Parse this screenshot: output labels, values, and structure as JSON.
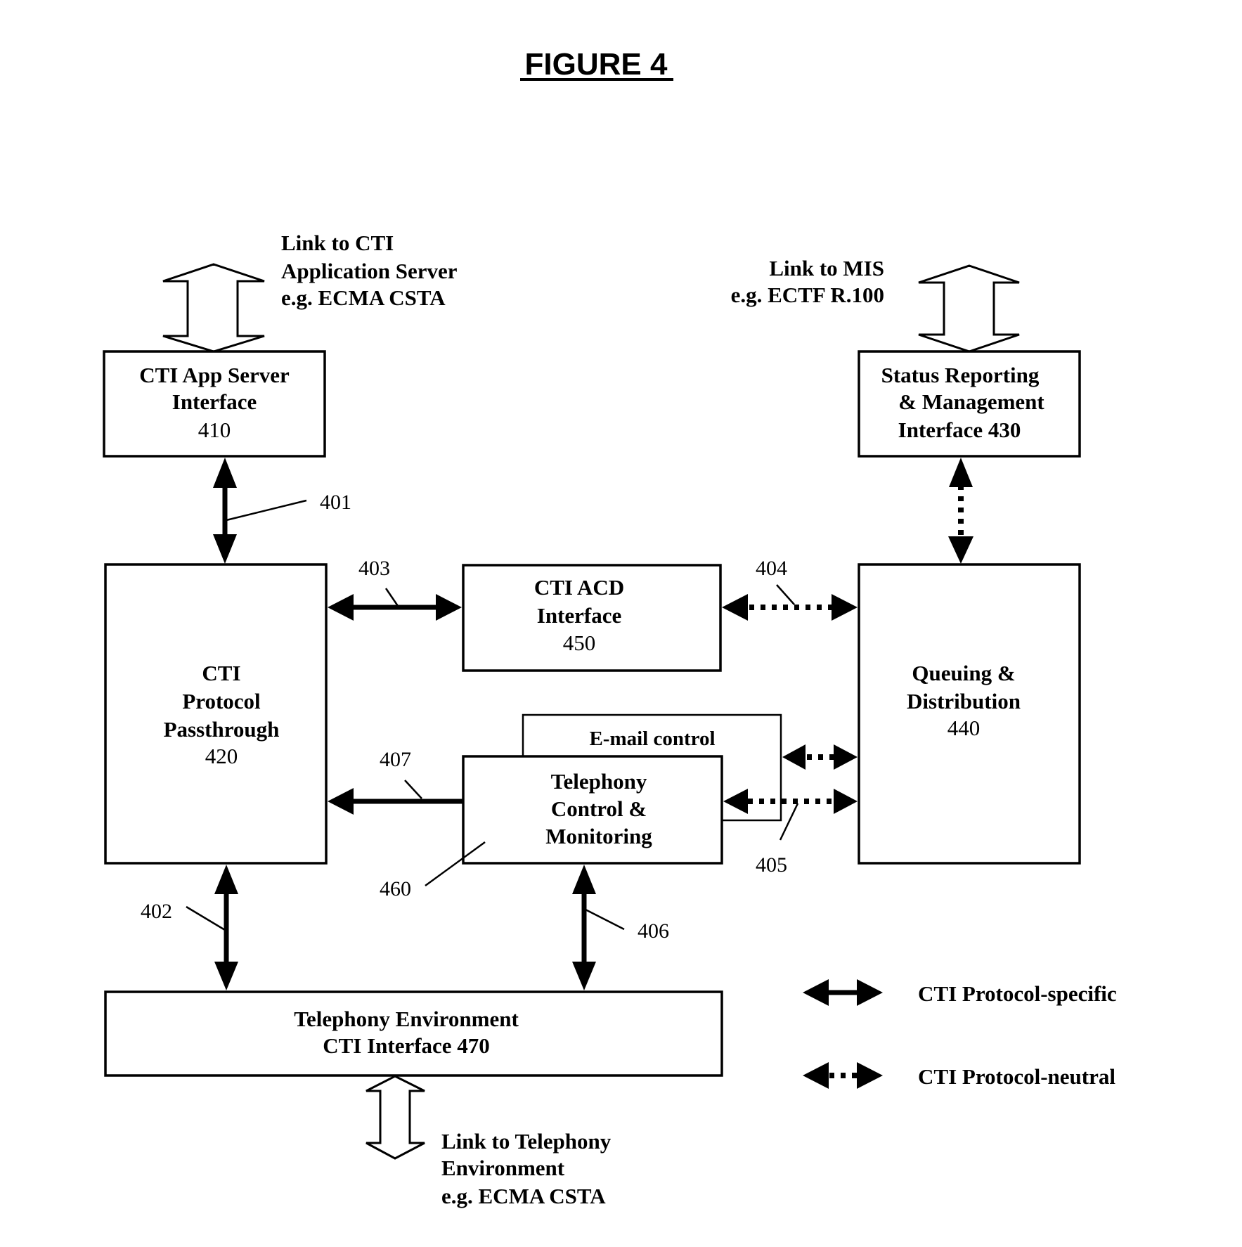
{
  "figure": {
    "title": "FIGURE 4"
  },
  "external_links": {
    "app_server": [
      "Link to CTI",
      "Application Server",
      "e.g. ECMA CSTA"
    ],
    "mis": [
      "Link to MIS",
      "e.g. ECTF R.100"
    ],
    "telephony": [
      "Link to Telephony",
      "Environment",
      "e.g. ECMA CSTA"
    ]
  },
  "blocks": {
    "b410": [
      "CTI App Server",
      "Interface",
      "410"
    ],
    "b430": [
      "Status Reporting",
      "& Management",
      "Interface 430"
    ],
    "b420": [
      "CTI",
      "Protocol",
      "Passthrough",
      "420"
    ],
    "b450": [
      "CTI ACD",
      "Interface",
      "450"
    ],
    "b440": [
      "Queuing &",
      "Distribution",
      "440"
    ],
    "email": "E-mail control",
    "b460": [
      "Telephony",
      "Control &",
      "Monitoring"
    ],
    "b470": [
      "Telephony Environment",
      "CTI Interface 470"
    ]
  },
  "connections": {
    "c401": "401",
    "c402": "402",
    "c403": "403",
    "c404": "404",
    "c405": "405",
    "c406": "406",
    "c407": "407",
    "c460": "460"
  },
  "legend": {
    "solid_label": "CTI Protocol-specific",
    "dotted_label": "CTI Protocol-neutral"
  }
}
